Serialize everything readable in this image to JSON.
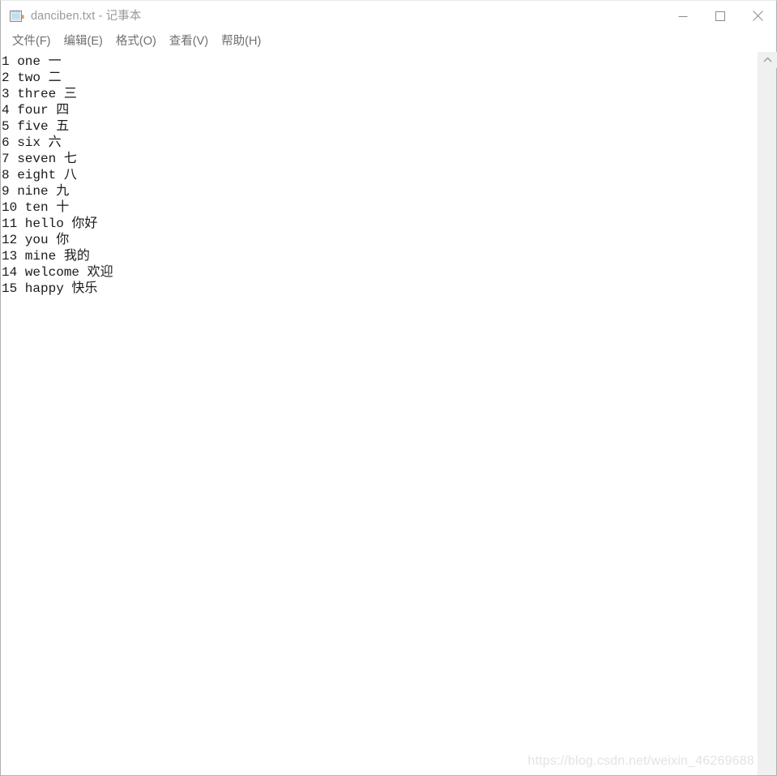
{
  "window": {
    "title": "danciben.txt - 记事本",
    "app_icon": "notepad-icon",
    "controls": {
      "minimize": "minimize-icon",
      "maximize": "maximize-icon",
      "close": "close-icon"
    }
  },
  "menubar": {
    "items": [
      {
        "label": "文件(F)"
      },
      {
        "label": "编辑(E)"
      },
      {
        "label": "格式(O)"
      },
      {
        "label": "查看(V)"
      },
      {
        "label": "帮助(H)"
      }
    ]
  },
  "editor": {
    "lines": [
      "1 one 一",
      "2 two 二",
      "3 three 三",
      "4 four 四",
      "5 five 五",
      "6 six 六",
      "7 seven 七",
      "8 eight 八",
      "9 nine 九",
      "10 ten 十",
      "11 hello 你好",
      "12 you 你",
      "13 mine 我的",
      "14 welcome 欢迎",
      "15 happy 快乐"
    ]
  },
  "scrollbar": {
    "up_arrow": "chevron-up-icon"
  },
  "watermark": {
    "text": "https://blog.csdn.net/weixin_46269688"
  },
  "colors": {
    "window_bg": "#ffffff",
    "title_text": "#9a9a9a",
    "menu_text": "#6f6f6f",
    "body_text": "#1a1a1a",
    "scrollbar_track": "#f0f0f0",
    "watermark": "#e3e3e3"
  }
}
